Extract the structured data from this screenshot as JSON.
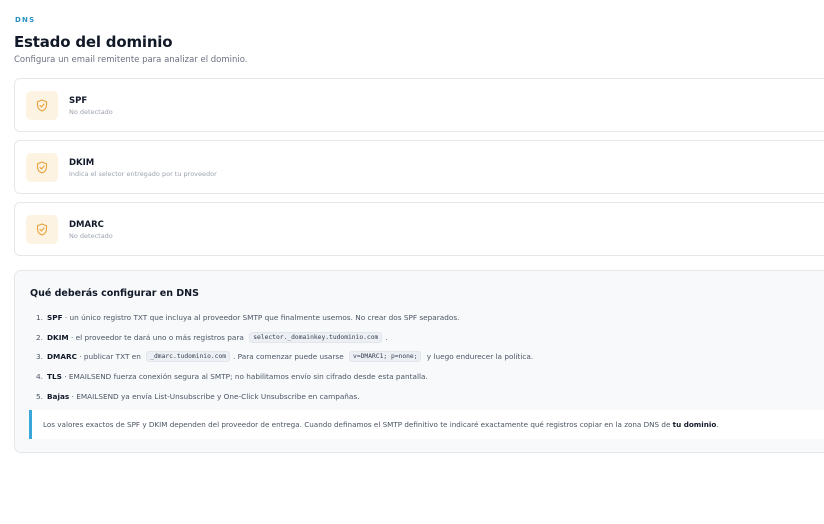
{
  "header": {
    "eyebrow": "DNS",
    "title": "Estado del dominio",
    "subtitle": "Configura un email remitente para analizar el dominio."
  },
  "records": [
    {
      "name": "SPF",
      "status": "No detectado"
    },
    {
      "name": "DKIM",
      "status": "Indica el selector entregado por tu proveedor"
    },
    {
      "name": "DMARC",
      "status": "No detectado"
    }
  ],
  "guide": {
    "title": "Qué deberás configurar en DNS",
    "steps": [
      {
        "num": "1.",
        "label": "SPF",
        "text": " · un único registro TXT que incluya al proveedor SMTP que finalmente usemos. No crear dos SPF separados."
      },
      {
        "num": "2.",
        "label": "DKIM",
        "text_a": " · el proveedor te dará uno o más registros para ",
        "code": "selector._domainkey.tudominio.com",
        "text_b": "."
      },
      {
        "num": "3.",
        "label": "DMARC",
        "text_a": " · publicar TXT en ",
        "code": "_dmarc.tudominio.com",
        "text_b": ". Para comenzar puede usarse ",
        "code2": "v=DMARC1; p=none;",
        "text_c": " y luego endurecer la política."
      },
      {
        "num": "4.",
        "label": "TLS",
        "text": " · EMAILSEND fuerza conexión segura al SMTP; no habilitamos envío sin cifrado desde esta pantalla."
      },
      {
        "num": "5.",
        "label": "Bajas",
        "text": " · EMAILSEND ya envía List-Unsubscribe y One-Click Unsubscribe en campañas."
      }
    ],
    "note_text": "Los valores exactos de SPF y DKIM dependen del proveedor de entrega. Cuando definamos el SMTP definitivo te indicaré exactamente qué registros copiar en la zona DNS de ",
    "note_bold": "tu dominio",
    "note_end": "."
  },
  "colors": {
    "accent": "#2b8fc7",
    "icon": "#e8a13a",
    "icon_bg": "#fdf3e3",
    "note_border": "#3aa7d9"
  },
  "icons": {
    "record": "shield-check-icon"
  }
}
